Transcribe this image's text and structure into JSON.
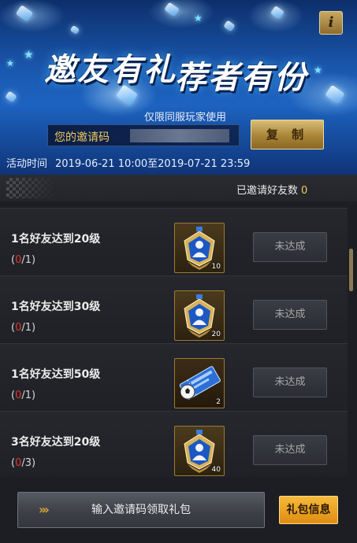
{
  "banner": {
    "title_left": "邀友有礼",
    "title_right": "荐者有份",
    "restriction_note": "仅限同服玩家使用",
    "invite_code_label": "您的邀请码",
    "copy_button": "复 制",
    "info_icon_glyph": "i",
    "activity_label": "活动时间",
    "activity_dates": "2019-06-21 10:00至2019-07-21 23:59"
  },
  "invited": {
    "label": "已邀请好友数",
    "count": "0"
  },
  "tasks": [
    {
      "title": "1名好友达到20级",
      "progress_open": "(",
      "progress_current": "0",
      "progress_total": "/1)",
      "reward_icon": "badge-crest-icon",
      "reward_qty": "10",
      "status": "未达成"
    },
    {
      "title": "1名好友达到30级",
      "progress_open": "(",
      "progress_current": "0",
      "progress_total": "/1)",
      "reward_icon": "badge-crest-icon",
      "reward_qty": "20",
      "status": "未达成"
    },
    {
      "title": "1名好友达到50级",
      "progress_open": "(",
      "progress_current": "0",
      "progress_total": "/1)",
      "reward_icon": "ticket-icon",
      "reward_qty": "2",
      "status": "未达成"
    },
    {
      "title": "3名好友达到20级",
      "progress_open": "(",
      "progress_current": "0",
      "progress_total": "/3)",
      "reward_icon": "badge-crest-icon",
      "reward_qty": "40",
      "status": "未达成"
    }
  ],
  "bottom": {
    "enter_code_button": "输入邀请码领取礼包",
    "gift_info_button": "礼包信息"
  },
  "colors": {
    "accent_gold": "#f0c95a",
    "progress_red": "#e0372c",
    "banner_blue": "#1a58b0"
  }
}
